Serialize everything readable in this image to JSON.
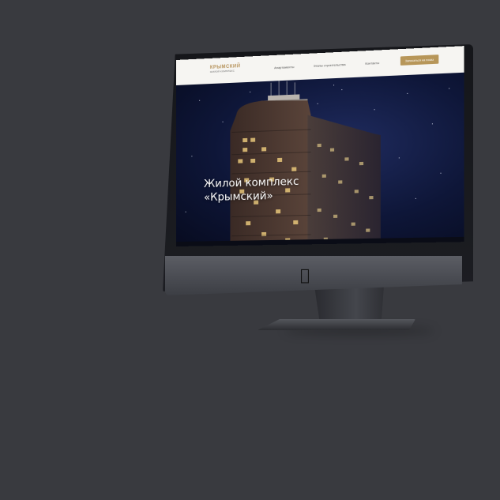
{
  "site": {
    "logo_title": "КРЫМСКИЙ",
    "logo_subtitle": "ЖИЛОЙ КОМПЛЕКС",
    "nav": [
      {
        "label": "Апартаменты"
      },
      {
        "label": "Этапы строительства"
      },
      {
        "label": "Контакты"
      }
    ],
    "cta_label": "Записаться на показ",
    "hero_title_line1": "Жилой комплекс",
    "hero_title_line2": "«Крымский»"
  },
  "colors": {
    "background": "#393a3f",
    "accent_gold": "#b79659",
    "header_bg": "#f6f5f2",
    "sky": "#0e1638"
  },
  "icons": {
    "device_logo": "apple-logo-icon"
  }
}
